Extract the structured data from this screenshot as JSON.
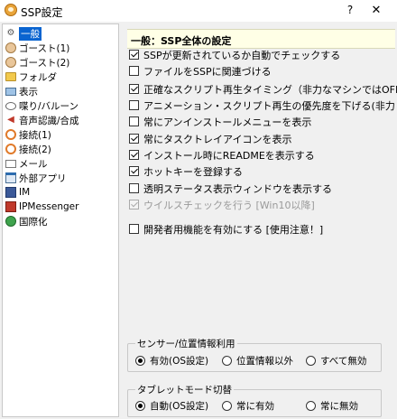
{
  "window": {
    "title": "SSP設定",
    "help_label": "?",
    "close_label": "✕"
  },
  "sidebar": {
    "items": [
      {
        "label": "一般",
        "selected": true,
        "icon": "gear-icon"
      },
      {
        "label": "ゴースト(1)",
        "icon": "ghost-icon"
      },
      {
        "label": "ゴースト(2)",
        "icon": "ghost-icon"
      },
      {
        "label": "フォルダ",
        "icon": "folder-icon"
      },
      {
        "label": "表示",
        "icon": "monitor-icon"
      },
      {
        "label": "喋り/バルーン",
        "icon": "speech-bubble-icon"
      },
      {
        "label": "音声認識/合成",
        "icon": "speaker-icon"
      },
      {
        "label": "接続(1)",
        "icon": "network-icon"
      },
      {
        "label": "接続(2)",
        "icon": "network-icon"
      },
      {
        "label": "メール",
        "icon": "mail-icon"
      },
      {
        "label": "外部アプリ",
        "icon": "app-icon"
      },
      {
        "label": "IM",
        "icon": "im-icon"
      },
      {
        "label": "IPMessenger",
        "icon": "messenger-icon"
      },
      {
        "label": "国際化",
        "icon": "globe-icon"
      }
    ]
  },
  "panel": {
    "header": "一般：SSP全体の設定",
    "options": [
      {
        "label": "SSPが更新されているか自動でチェックする",
        "checked": true
      },
      {
        "label": "ファイルをSSPに関連づける",
        "checked": false
      },
      {
        "label": "正確なスクリプト再生タイミング（非力なマシンではOFF）",
        "checked": true
      },
      {
        "label": "アニメーション・スクリプト再生の優先度を下げる(非力なマシンでON",
        "checked": false
      },
      {
        "label": "常にアンインストールメニューを表示",
        "checked": false
      },
      {
        "label": "常にタスクトレイアイコンを表示",
        "checked": true
      },
      {
        "label": "インストール時にREADMEを表示する",
        "checked": true
      },
      {
        "label": "ホットキーを登録する",
        "checked": true
      },
      {
        "label": "透明ステータス表示ウィンドウを表示する",
        "checked": false
      },
      {
        "label": "ウイルスチェックを行う [Win10以降]",
        "checked": true,
        "disabled": true
      },
      {
        "label": "開発者用機能を有効にする [使用注意！]",
        "checked": false
      }
    ]
  },
  "sensor_group": {
    "title": "センサー/位置情報利用",
    "options": [
      {
        "label": "有効(OS設定)",
        "selected": true
      },
      {
        "label": "位置情報以外",
        "selected": false
      },
      {
        "label": "すべて無効",
        "selected": false
      }
    ]
  },
  "tablet_group": {
    "title": "タブレットモード切替",
    "options": [
      {
        "label": "自動(OS設定)",
        "selected": true
      },
      {
        "label": "常に有効",
        "selected": false
      },
      {
        "label": "常に無効",
        "selected": false
      }
    ]
  }
}
